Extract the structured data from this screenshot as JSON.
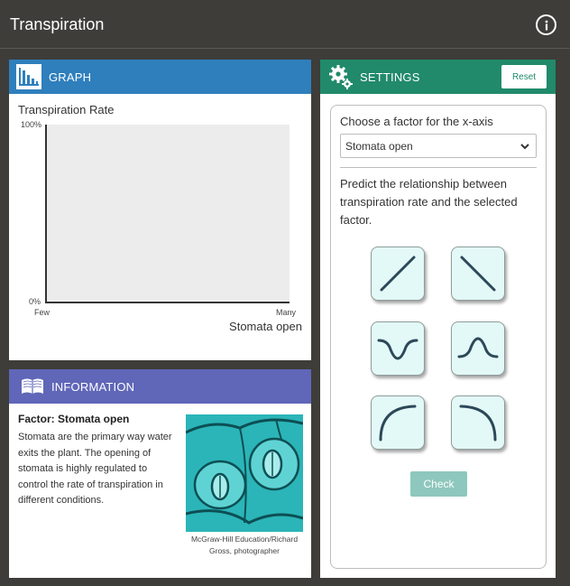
{
  "app": {
    "title": "Transpiration"
  },
  "graph": {
    "header": "GRAPH",
    "y_label": "Transpiration Rate",
    "y_top": "100%",
    "y_bottom": "0%",
    "x_left": "Few",
    "x_right": "Many",
    "x_label": "Stomata open"
  },
  "info": {
    "header": "INFORMATION",
    "factor_title": "Factor: Stomata open",
    "text": "Stomata are the primary way water exits the plant. The opening of stomata is highly regulated to control the rate of transpiration in different conditions.",
    "photo_credit": "McGraw-Hill Education/Richard Gross, photographer"
  },
  "settings": {
    "header": "SETTINGS",
    "reset_label": "Reset",
    "choose_label": "Choose a factor for the x-axis",
    "selected_factor": "Stomata open",
    "predict_text": "Predict the relationship between transpiration rate and the selected factor.",
    "check_label": "Check",
    "shape_options": [
      "increasing-line",
      "decreasing-line",
      "u-shape",
      "bell-shape",
      "saturating-curve",
      "declining-curve"
    ]
  },
  "colors": {
    "graph_header": "#2f7fbd",
    "info_header": "#6066b8",
    "settings_header": "#218a6a",
    "shape_bg": "#e3f9f7",
    "check_bg": "#8ec7bd"
  }
}
